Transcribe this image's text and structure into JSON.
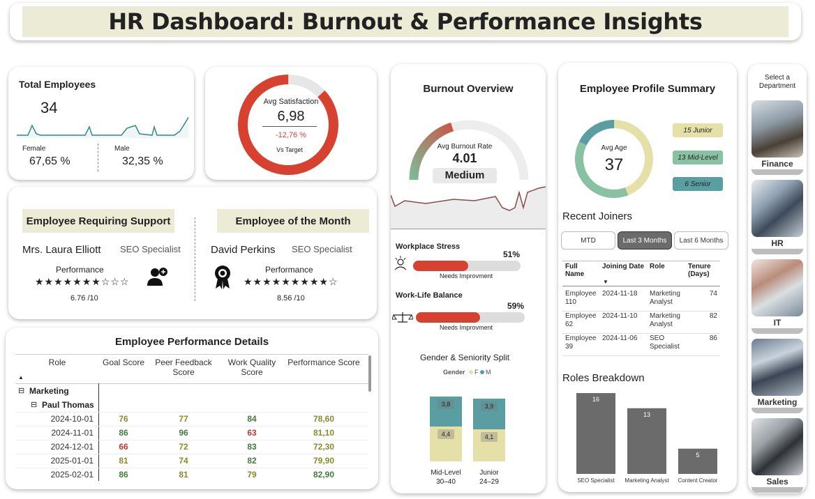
{
  "title": "HR Dashboard: Burnout & Performance Insights",
  "total": {
    "label": "Total Employees",
    "value": "34",
    "female_label": "Female",
    "female_value": "67,65 %",
    "male_label": "Male",
    "male_value": "32,35 %"
  },
  "satisfaction": {
    "label": "Avg Satisfaction",
    "value": "6,98",
    "delta": "-12,76 %",
    "vs": "Vs Target",
    "fill_fraction": 0.87
  },
  "support": {
    "header": "Employee Requiring Support",
    "name": "Mrs. Laura Elliott",
    "role": "SEO Specialist",
    "perf_label": "Performance",
    "stars": "★★★★★★★☆☆☆",
    "score": "6.76 /10"
  },
  "month": {
    "header": "Employee of the Month",
    "name": "David Perkins",
    "role": "SEO Specialist",
    "perf_label": "Performance",
    "stars": "★★★★★★★★★☆",
    "score": "8.56 /10"
  },
  "perf_table": {
    "title": "Employee Performance Details",
    "columns": [
      "Role",
      "Goal Score",
      "Peer Feedback Score",
      "Work Quality Score",
      "Performance Score"
    ],
    "group": "Marketing",
    "subgroup": "Paul Thomas",
    "rows": [
      {
        "date": "2024-10-01",
        "goal": "76",
        "peer": "77",
        "quality": "84",
        "perf": "78,60"
      },
      {
        "date": "2024-11-01",
        "goal": "86",
        "peer": "96",
        "quality": "63",
        "perf": "81,10"
      },
      {
        "date": "2024-12-01",
        "goal": "66",
        "peer": "72",
        "quality": "83",
        "perf": "72,30"
      },
      {
        "date": "2025-01-01",
        "goal": "81",
        "peer": "74",
        "quality": "82",
        "perf": "79,90"
      },
      {
        "date": "2025-02-01",
        "goal": "86",
        "peer": "81",
        "quality": "79",
        "perf": "82,90"
      }
    ],
    "colors": {
      "green": "#3f7d3a",
      "olive": "#8a8a2a",
      "red": "#c0392b"
    }
  },
  "burnout": {
    "title": "Burnout Overview",
    "gauge_label": "Avg Burnout Rate",
    "gauge_value": "4.01",
    "level": "Medium",
    "stress_label": "Workplace Stress",
    "stress_pct": "51%",
    "stress_fraction": 0.51,
    "stress_note": "Needs Improvment",
    "balance_label": "Work-Life Balance",
    "balance_pct": "59%",
    "balance_fraction": 0.59,
    "balance_note": "Needs Improvment",
    "split_title": "Gender & Seniority Split",
    "legend_label": "Gender",
    "legend_f": "F",
    "legend_m": "M",
    "bars": [
      {
        "cat": "Mid-Level",
        "range": "30–40",
        "f": 4.4,
        "m": 3.8,
        "f_label": "4,4",
        "m_label": "3,8"
      },
      {
        "cat": "Junior",
        "range": "24–29",
        "f": 4.1,
        "m": 3.9,
        "f_label": "4,1",
        "m_label": "3,9"
      }
    ],
    "colors": {
      "f": "#e5e0a8",
      "m": "#5a9ea2",
      "bar_red": "#d7412f",
      "track": "#dcdcdc"
    }
  },
  "profile": {
    "title": "Employee Profile Summary",
    "age_label": "Avg Age",
    "age_value": "37",
    "pills": [
      "15 Junior",
      "13 Mid-Level",
      "6 Senior"
    ],
    "pill_counts": [
      15,
      13,
      6
    ],
    "recent_title": "Recent Joiners",
    "filters": [
      "MTD",
      "Last 3 Months",
      "Last 6 Months"
    ],
    "active_filter": "Last 3 Months",
    "table_headers": [
      "Full Name",
      "Joining Date",
      "Role",
      "Tenure (Days)"
    ],
    "joiners": [
      {
        "name": "Employee 110",
        "date": "2024-11-18",
        "role": "Marketing Analyst",
        "tenure": "74"
      },
      {
        "name": "Employee 62",
        "date": "2024-11-10",
        "role": "Marketing Analyst",
        "tenure": "82"
      },
      {
        "name": "Employee 39",
        "date": "2024-11-06",
        "role": "SEO Specialist",
        "tenure": "86"
      }
    ],
    "roles_title": "Roles Breakdown"
  },
  "chart_data": {
    "type": "bar",
    "categories": [
      "SEO Specialist",
      "Marketing Analyst",
      "Content Creator"
    ],
    "values": [
      16,
      13,
      5
    ],
    "title": "Roles Breakdown",
    "ylim": [
      0,
      16
    ]
  },
  "departments": {
    "prompt": "Select a Department",
    "items": [
      "Finance",
      "HR",
      "IT",
      "Marketing",
      "Sales"
    ]
  }
}
